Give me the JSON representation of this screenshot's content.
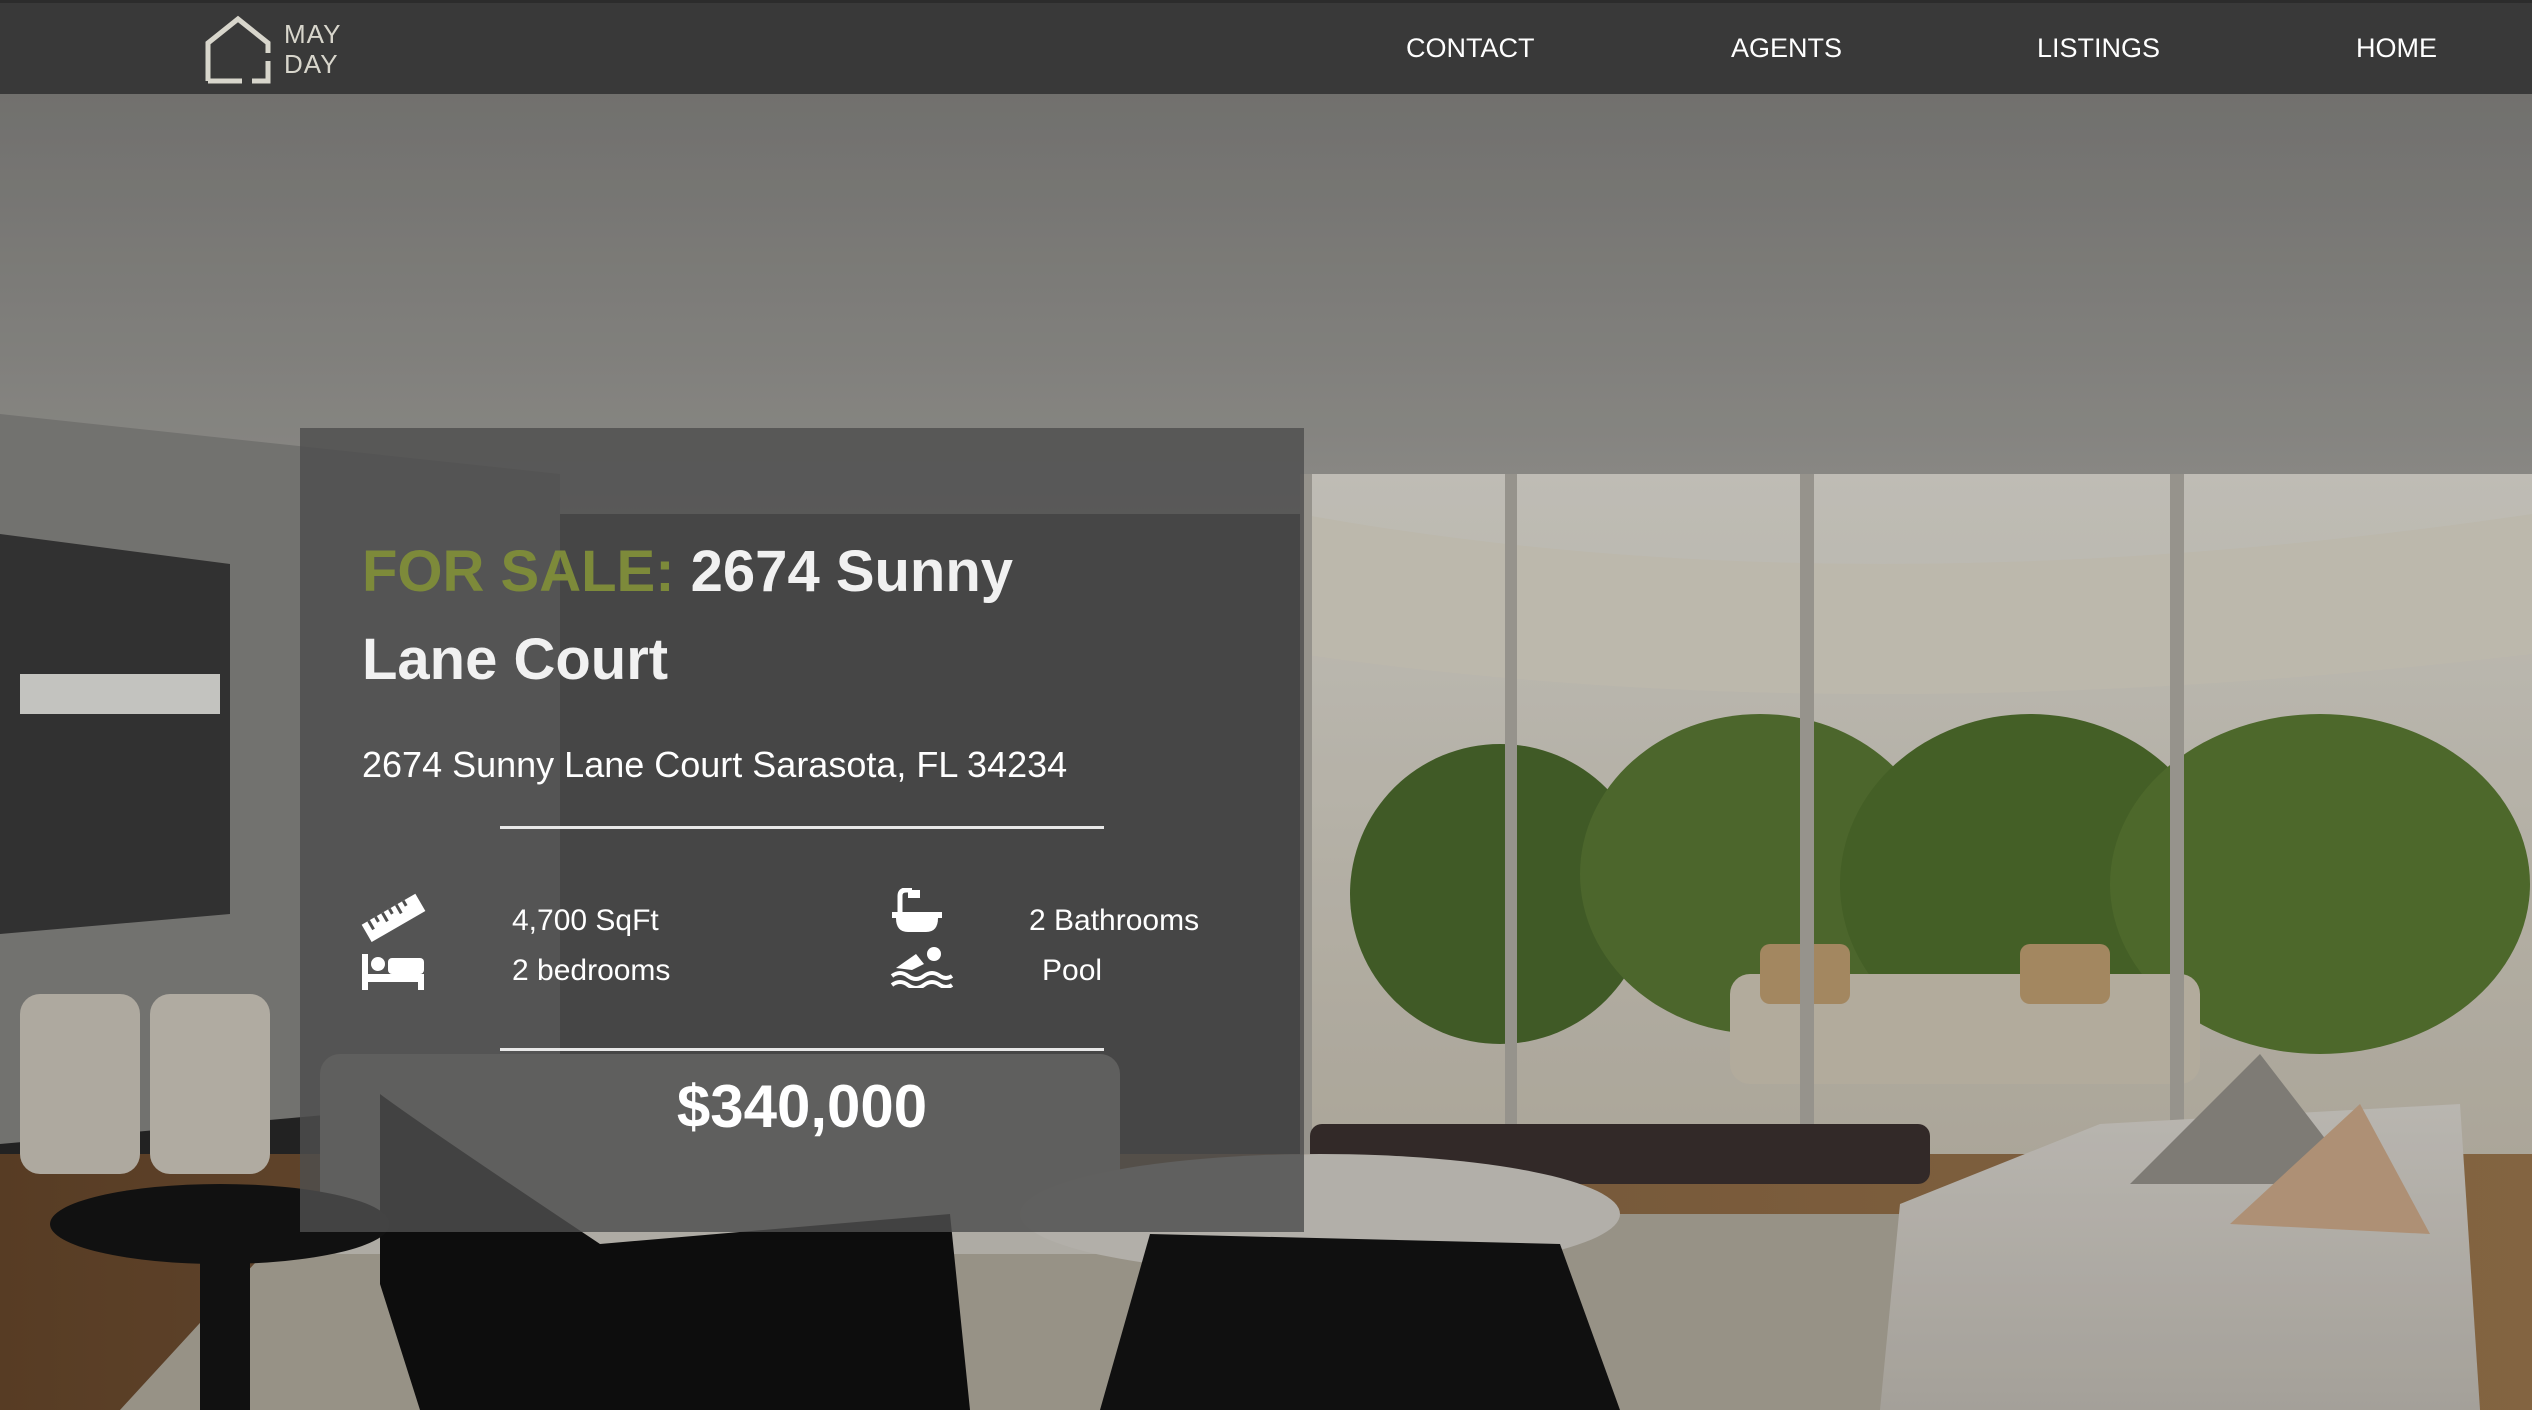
{
  "brand": {
    "line1": "MAY",
    "line2": "DAY"
  },
  "nav": {
    "contact": "CONTACT",
    "agents": "AGENTS",
    "listings": "LISTINGS",
    "home": "HOME"
  },
  "listing": {
    "sale_label": "FOR SALE:",
    "title": "2674 Sunny Lane Court",
    "address": "2674 Sunny Lane Court Sarasota, FL 34234",
    "features": {
      "sqft": "4,700 SqFt",
      "bedrooms": "2 bedrooms",
      "bathrooms": "2 Bathrooms",
      "pool": "Pool"
    },
    "price": "$340,000"
  },
  "colors": {
    "navbar": "#393939",
    "sale_accent": "#7d8a3a",
    "card_overlay": "rgba(78,78,78,0.82)"
  },
  "icons": [
    "house-logo-icon",
    "ruler-icon",
    "bed-icon",
    "bathtub-icon",
    "swimmer-icon"
  ]
}
